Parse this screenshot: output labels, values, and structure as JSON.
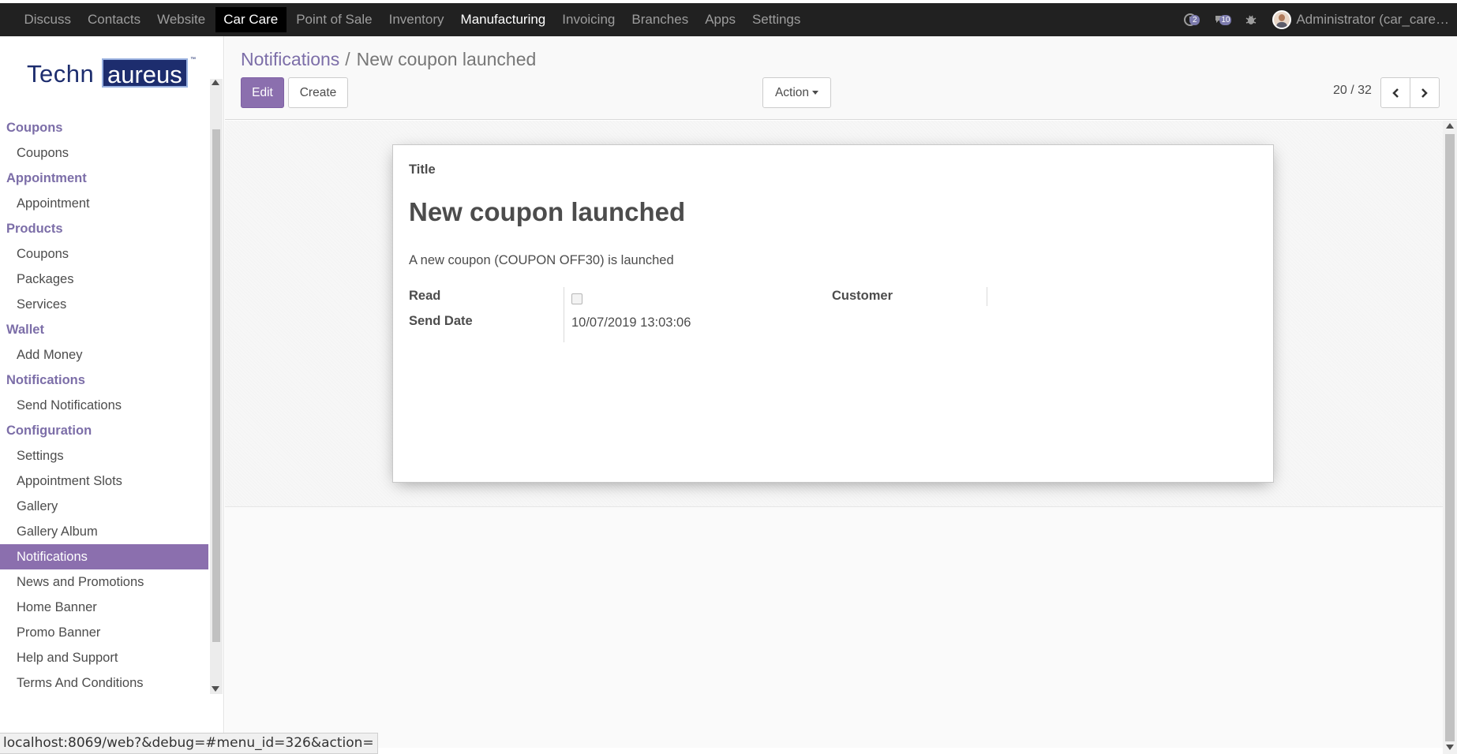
{
  "topbar": {
    "menu": [
      "Discuss",
      "Contacts",
      "Website",
      "Car Care",
      "Point of Sale",
      "Inventory",
      "Manufacturing",
      "Invoicing",
      "Branches",
      "Apps",
      "Settings"
    ],
    "active": "Car Care",
    "activity_count": "2",
    "messages_count": "10",
    "user_name": "Administrator (car_care…"
  },
  "sidebar": {
    "logo_left": "Techn",
    "logo_right": "aureus",
    "logo_tm": "™",
    "sections": [
      {
        "title": "Coupons",
        "items": [
          "Coupons"
        ]
      },
      {
        "title": "Appointment",
        "items": [
          "Appointment"
        ]
      },
      {
        "title": "Products",
        "items": [
          "Coupons",
          "Packages",
          "Services"
        ]
      },
      {
        "title": "Wallet",
        "items": [
          "Add Money"
        ]
      },
      {
        "title": "Notifications",
        "items": [
          "Send Notifications"
        ]
      },
      {
        "title": "Configuration",
        "items": [
          "Settings",
          "Appointment Slots",
          "Gallery",
          "Gallery Album",
          "Notifications",
          "News and Promotions",
          "Home Banner",
          "Promo Banner",
          "Help and Support",
          "Terms And Conditions"
        ]
      }
    ],
    "active_item": "Notifications"
  },
  "control_panel": {
    "breadcrumb_parent": "Notifications",
    "breadcrumb_sep": "/",
    "breadcrumb_current": "New coupon launched",
    "edit_label": "Edit",
    "create_label": "Create",
    "action_label": "Action",
    "pager": "20 / 32"
  },
  "record": {
    "title_label": "Title",
    "title": "New coupon launched",
    "message": "A new coupon (COUPON OFF30) is launched",
    "read_label": "Read",
    "read_checked": false,
    "send_date_label": "Send Date",
    "send_date": "10/07/2019 13:03:06",
    "customer_label": "Customer",
    "customer": ""
  },
  "statusbar": "localhost:8069/web?&debug=#menu_id=326&action=",
  "colors": {
    "accent": "#8b6fae",
    "navbar": "#212121",
    "section": "#7c6ea8"
  }
}
